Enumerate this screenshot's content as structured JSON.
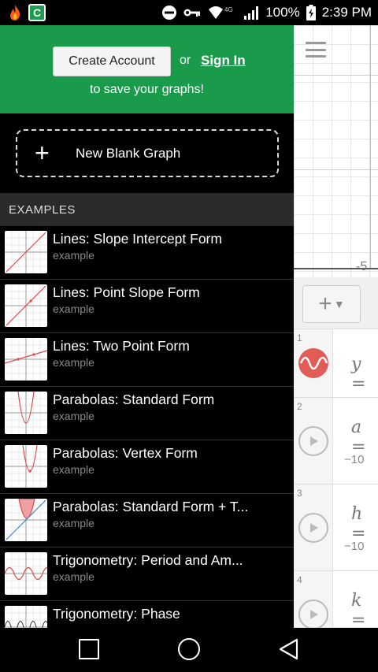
{
  "status_bar": {
    "battery": "100%",
    "time": "2:39 PM",
    "network": "4G",
    "icons": [
      "flame-icon",
      "c-app-icon",
      "do-not-disturb-icon",
      "key-icon",
      "wifi-icon",
      "signal-icon",
      "battery-icon"
    ]
  },
  "account": {
    "create_label": "Create Account",
    "or_label": "or",
    "signin_label": "Sign In",
    "save_text": "to save your graphs!"
  },
  "new_blank": {
    "plus": "+",
    "label": "New Blank Graph"
  },
  "examples": {
    "header": "EXAMPLES",
    "items": [
      {
        "title": "Lines: Slope Intercept Form",
        "sub": "example"
      },
      {
        "title": "Lines: Point Slope Form",
        "sub": "example"
      },
      {
        "title": "Lines: Two Point Form",
        "sub": "example"
      },
      {
        "title": "Parabolas: Standard Form",
        "sub": "example"
      },
      {
        "title": "Parabolas: Vertex Form",
        "sub": "example"
      },
      {
        "title": "Parabolas: Standard Form + T...",
        "sub": "example"
      },
      {
        "title": "Trigonometry: Period and Am...",
        "sub": "example"
      },
      {
        "title": "Trigonometry: Phase",
        "sub": ""
      }
    ]
  },
  "graph": {
    "axis_label": "-5",
    "add_button": "+",
    "expressions": [
      {
        "num": "1",
        "text": "y =",
        "sub": ""
      },
      {
        "num": "2",
        "text": "a =",
        "sub": "−10"
      },
      {
        "num": "3",
        "text": "h =",
        "sub": "−10"
      },
      {
        "num": "4",
        "text": "k =",
        "sub": ""
      }
    ]
  },
  "colors": {
    "brand_green": "#1a9b4b",
    "curve_red": "#e25b57"
  }
}
